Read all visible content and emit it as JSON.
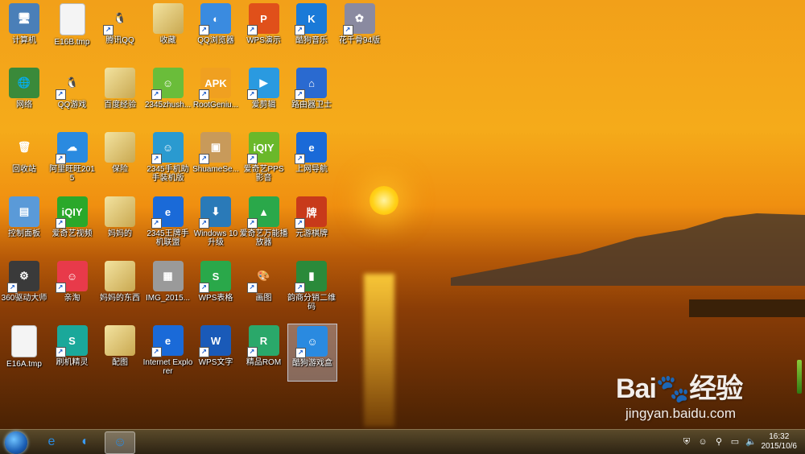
{
  "icons": [
    {
      "label": "计算机",
      "col": 0,
      "row": 0,
      "glyph": "🖥",
      "bg": "#4a7fb8"
    },
    {
      "label": "E16B.tmp",
      "col": 1,
      "row": 0,
      "glyph": "",
      "bg": "#f4f4f4"
    },
    {
      "label": "腾讯QQ",
      "col": 2,
      "row": 0,
      "glyph": "🐧",
      "bg": "transparent"
    },
    {
      "label": "收藏",
      "col": 3,
      "row": 0,
      "glyph": "",
      "bg": "#d8c47a"
    },
    {
      "label": "QQ浏览器",
      "col": 4,
      "row": 0,
      "glyph": "◐",
      "bg": "#3a8be0"
    },
    {
      "label": "WPS演示",
      "col": 5,
      "row": 0,
      "glyph": "P",
      "bg": "#e0501a"
    },
    {
      "label": "酷狗音乐",
      "col": 6,
      "row": 0,
      "glyph": "K",
      "bg": "#1a7ad8"
    },
    {
      "label": "花千骨94版",
      "col": 7,
      "row": 0,
      "glyph": "✿",
      "bg": "#8a8aa0"
    },
    {
      "label": "网络",
      "col": 0,
      "row": 1,
      "glyph": "🌐",
      "bg": "#3a8a3a"
    },
    {
      "label": "QQ游戏",
      "col": 1,
      "row": 1,
      "glyph": "🐧",
      "bg": "transparent"
    },
    {
      "label": "百度经验",
      "col": 2,
      "row": 1,
      "glyph": "",
      "bg": "#d8c47a"
    },
    {
      "label": "2345zhush...",
      "col": 3,
      "row": 1,
      "glyph": "☺",
      "bg": "#6abd3a"
    },
    {
      "label": "RootGeniu...",
      "col": 4,
      "row": 1,
      "glyph": "APK",
      "bg": "#f0a020"
    },
    {
      "label": "爱剪辑",
      "col": 5,
      "row": 1,
      "glyph": "▶",
      "bg": "#2a9ae0"
    },
    {
      "label": "路由器卫士",
      "col": 6,
      "row": 1,
      "glyph": "⌂",
      "bg": "#2a6ad0"
    },
    {
      "label": "回收站",
      "col": 0,
      "row": 2,
      "glyph": "🗑",
      "bg": "transparent"
    },
    {
      "label": "阿里旺旺2015",
      "col": 1,
      "row": 2,
      "glyph": "☁",
      "bg": "#2a8ae0"
    },
    {
      "label": "保险",
      "col": 2,
      "row": 2,
      "glyph": "",
      "bg": "#d8c47a"
    },
    {
      "label": "2345手机助手装机版",
      "col": 3,
      "row": 2,
      "glyph": "☺",
      "bg": "#2a9ad0"
    },
    {
      "label": "ShuameSe...",
      "col": 4,
      "row": 2,
      "glyph": "▣",
      "bg": "#c89a5a"
    },
    {
      "label": "爱奇艺PPS 影音",
      "col": 5,
      "row": 2,
      "glyph": "iQIY",
      "bg": "#6ab82a"
    },
    {
      "label": "上网导航",
      "col": 6,
      "row": 2,
      "glyph": "e",
      "bg": "#1a6ad8"
    },
    {
      "label": "控制面板",
      "col": 0,
      "row": 3,
      "glyph": "▤",
      "bg": "#5a9ad8"
    },
    {
      "label": "爱奇艺视频",
      "col": 1,
      "row": 3,
      "glyph": "iQIY",
      "bg": "#2aa82a"
    },
    {
      "label": "妈妈的",
      "col": 2,
      "row": 3,
      "glyph": "",
      "bg": "#d8c47a"
    },
    {
      "label": "2345王牌手机联盟",
      "col": 3,
      "row": 3,
      "glyph": "e",
      "bg": "#1a6ad8"
    },
    {
      "label": "Windows 10 升级",
      "col": 4,
      "row": 3,
      "glyph": "⬇",
      "bg": "#2a7ab8"
    },
    {
      "label": "爱奇艺万能播放器",
      "col": 5,
      "row": 3,
      "glyph": "▲",
      "bg": "#2aa84a"
    },
    {
      "label": "元游棋牌",
      "col": 6,
      "row": 3,
      "glyph": "牌",
      "bg": "#c83a1a"
    },
    {
      "label": "360驱动大师",
      "col": 0,
      "row": 4,
      "glyph": "⚙",
      "bg": "#3a3a3a"
    },
    {
      "label": "亲淘",
      "col": 1,
      "row": 4,
      "glyph": "☺",
      "bg": "#e83a4a"
    },
    {
      "label": "妈妈的东西",
      "col": 2,
      "row": 4,
      "glyph": "",
      "bg": "#d8c47a"
    },
    {
      "label": "IMG_2015...",
      "col": 3,
      "row": 4,
      "glyph": "▦",
      "bg": "#9a9a9a"
    },
    {
      "label": "WPS表格",
      "col": 4,
      "row": 4,
      "glyph": "S",
      "bg": "#2aa84a"
    },
    {
      "label": "画图",
      "col": 5,
      "row": 4,
      "glyph": "🎨",
      "bg": "transparent"
    },
    {
      "label": "韵商分销二维码",
      "col": 6,
      "row": 4,
      "glyph": "▮",
      "bg": "#2a8a3a"
    },
    {
      "label": "E16A.tmp",
      "col": 0,
      "row": 5,
      "glyph": "",
      "bg": "#f4f4f4"
    },
    {
      "label": "刷机精灵",
      "col": 1,
      "row": 5,
      "glyph": "S",
      "bg": "#1aa89a"
    },
    {
      "label": "配图",
      "col": 2,
      "row": 5,
      "glyph": "",
      "bg": "#d8c47a"
    },
    {
      "label": "Internet Explorer",
      "col": 3,
      "row": 5,
      "glyph": "e",
      "bg": "#1a6ad8"
    },
    {
      "label": "WPS文字",
      "col": 4,
      "row": 5,
      "glyph": "W",
      "bg": "#1a5ab8"
    },
    {
      "label": "精品ROM",
      "col": 5,
      "row": 5,
      "glyph": "R",
      "bg": "#2aa86a"
    },
    {
      "label": "酷狗游戏盒",
      "col": 6,
      "row": 5,
      "glyph": "☺",
      "bg": "#2a8ae0",
      "selected": true
    }
  ],
  "taskbar": {
    "pinned": [
      {
        "name": "ie",
        "glyph": "e",
        "color": "#2a8ae0"
      },
      {
        "name": "qq-browser",
        "glyph": "◐",
        "color": "#3a9af0"
      },
      {
        "name": "kugou-game-box",
        "glyph": "☺",
        "color": "#2a8ae0",
        "active": true
      }
    ],
    "tray_icons": [
      "shield",
      "kugou",
      "network-device",
      "monitor",
      "volume"
    ],
    "time": "16:32",
    "date": "2015/10/6"
  },
  "watermark": {
    "logo": "Bai🐾经验",
    "url": "jingyan.baidu.com"
  }
}
